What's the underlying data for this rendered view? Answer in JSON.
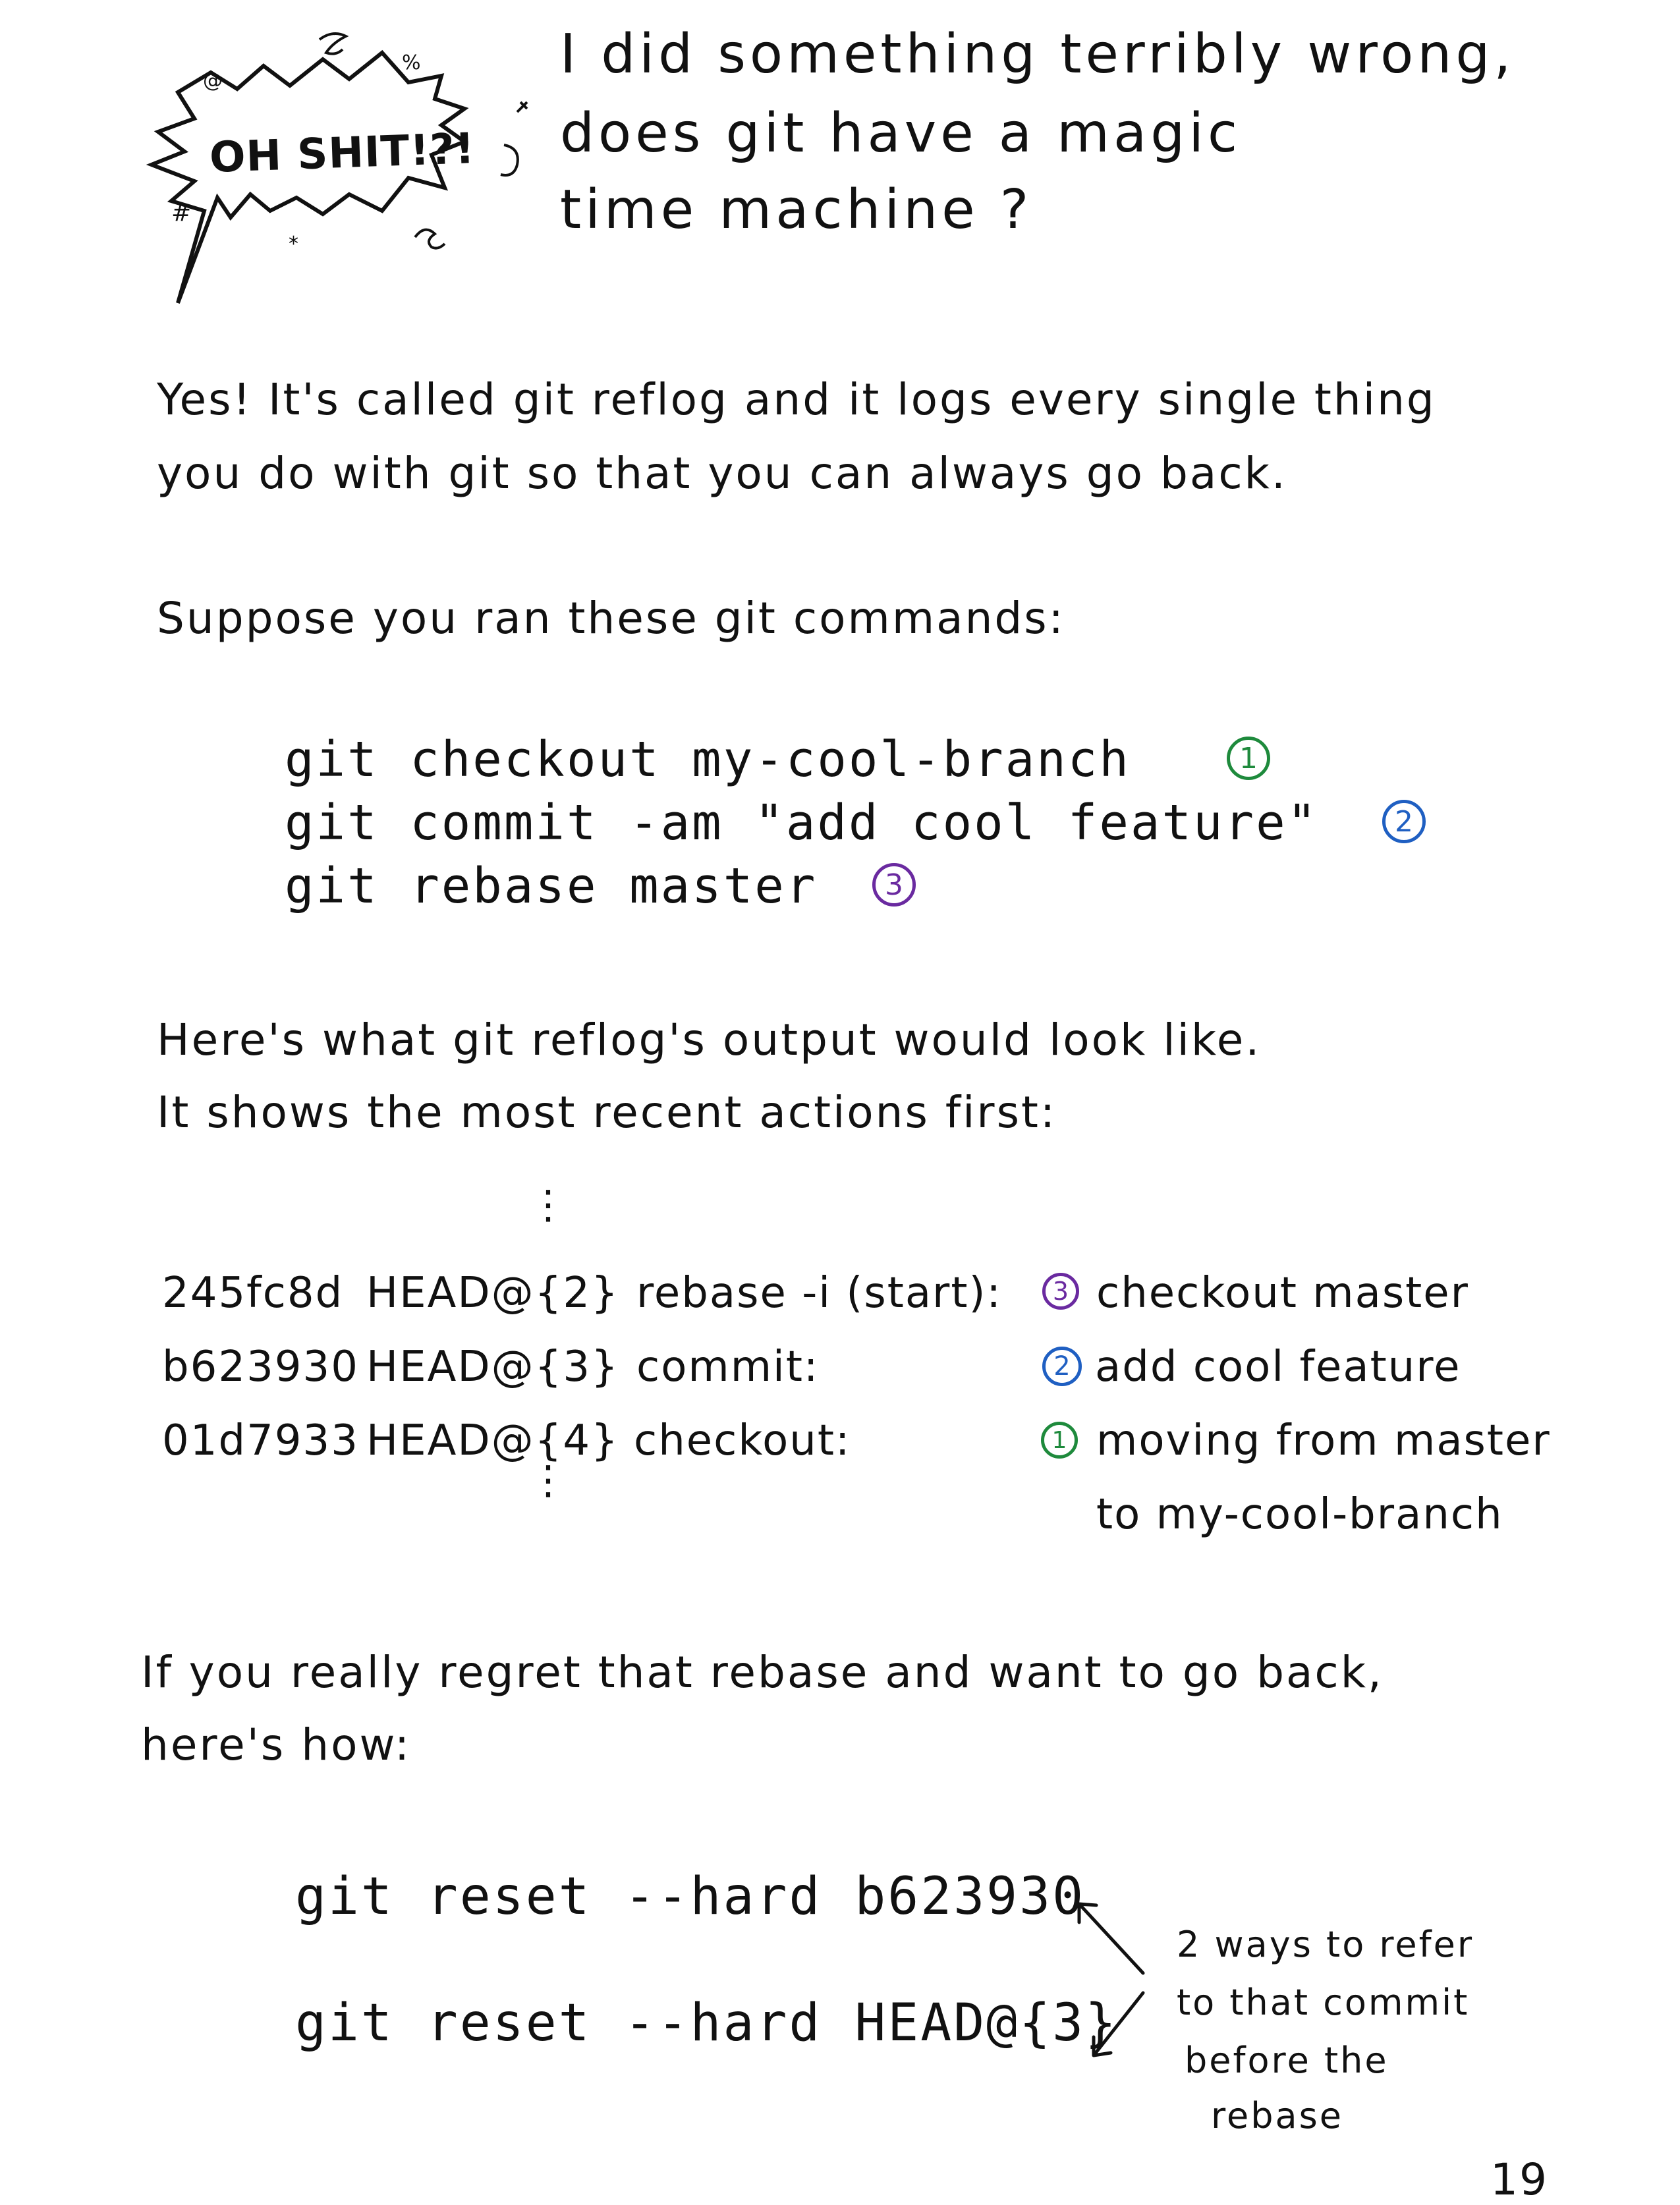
{
  "burst": {
    "label": "OH SHIT!?!"
  },
  "header": {
    "question_lines": [
      "I did something terribly wrong,",
      "does git have a magic",
      "time machine ?"
    ]
  },
  "intro": {
    "lines": [
      "Yes! It's called git reflog and it logs every single thing",
      "you do with git so that you can always go back."
    ]
  },
  "suppose": {
    "text": "Suppose you ran these git commands:"
  },
  "commands": [
    {
      "text": "git checkout my-cool-branch",
      "badge": "1",
      "badge_color": "#1e8a3c"
    },
    {
      "text": "git commit -am \"add cool feature\"",
      "badge": "2",
      "badge_color": "#1f5fc2"
    },
    {
      "text": "git rebase master",
      "badge": "3",
      "badge_color": "#6a2aa0"
    }
  ],
  "reflog_intro": {
    "lines": [
      "Here's what git reflog's output would look like.",
      "It shows the most recent actions first:"
    ]
  },
  "reflog": {
    "ellipsis": "⋮",
    "rows": [
      {
        "hash": "245fc8d",
        "ref": "HEAD@{2}",
        "action": "rebase -i (start):",
        "badge": "3",
        "message": "checkout master"
      },
      {
        "hash": "b623930",
        "ref": "HEAD@{3}",
        "action": "commit:",
        "badge": "2",
        "message": "add cool feature"
      },
      {
        "hash": "01d7933",
        "ref": "HEAD@{4}",
        "action": "checkout:",
        "badge": "1",
        "message": "moving from master",
        "message_2": "to my-cool-branch"
      }
    ]
  },
  "regret": {
    "lines": [
      "If you really regret that rebase and want to go back,",
      "here's how:"
    ]
  },
  "resets": [
    "git reset --hard b623930",
    "git reset --hard HEAD@{3}"
  ],
  "annotation": {
    "lines": [
      "2 ways to refer",
      "to that commit",
      "before the",
      "rebase"
    ]
  },
  "page_number": "19",
  "colors": {
    "green": "#1e8a3c",
    "blue": "#1f5fc2",
    "purple": "#6a2aa0",
    "ink": "#111111"
  }
}
